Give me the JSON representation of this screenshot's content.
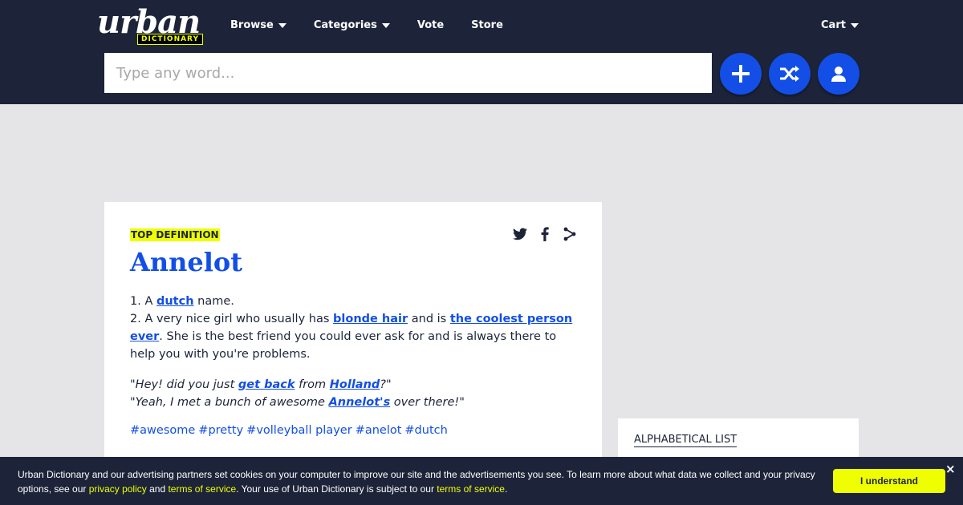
{
  "logo": {
    "main": "urban",
    "sub": "DICTIONARY"
  },
  "nav": {
    "browse": "Browse",
    "categories": "Categories",
    "vote": "Vote",
    "store": "Store",
    "cart": "Cart"
  },
  "search": {
    "placeholder": "Type any word..."
  },
  "definition": {
    "badge": "TOP DEFINITION",
    "word": "Annelot",
    "meaning": {
      "l1_pre": "1. A ",
      "l1_link": "dutch",
      "l1_post": " name.",
      "l2_pre": "2. A very nice girl who usually has ",
      "l2_link1": "blonde hair",
      "l2_mid": " and is ",
      "l2_link2": "the coolest person ever",
      "l2_post": ". She is the best friend you could ever ask for and is always there to help you with you're problems."
    },
    "example": {
      "e1_pre": "\"Hey! did you just ",
      "e1_link1": "get back",
      "e1_mid": " from ",
      "e1_link2": "Holland",
      "e1_post": "?\"",
      "e2_pre": "\"Yeah, I met a bunch of awesome ",
      "e2_link": "Annelot's",
      "e2_post": " over there!\""
    },
    "tags": [
      "#awesome",
      "#pretty",
      "#volleyball player",
      "#anelot",
      "#dutch"
    ]
  },
  "sidebar": {
    "alpha_title": "ALPHABETICAL LIST"
  },
  "cookie": {
    "t1": "Urban Dictionary and our advertising partners set cookies on your computer to improve our site and the advertisements you see. To learn more about what data we collect and your privacy options, see our ",
    "privacy": "privacy policy",
    "and": " and ",
    "terms1": "terms of service",
    "t2": ". Your use of Urban Dictionary is subject to our ",
    "terms2": "terms of service",
    "t3": ".",
    "button": "I understand",
    "close": "×"
  },
  "colors": {
    "navy": "#1d2439",
    "blue": "#134fe6",
    "yellow": "#efff00"
  }
}
